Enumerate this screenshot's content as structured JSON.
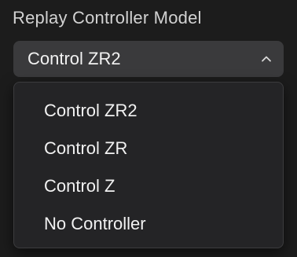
{
  "field": {
    "label": "Replay Controller Model"
  },
  "select": {
    "value": "Control ZR2",
    "chevron_icon": "chevron-up-icon"
  },
  "menu": {
    "items": [
      {
        "label": "Control ZR2"
      },
      {
        "label": "Control ZR"
      },
      {
        "label": "Control Z"
      },
      {
        "label": "No Controller"
      }
    ]
  },
  "colors": {
    "background": "#1c1c1c",
    "select_bg": "#3a3a3c",
    "menu_bg": "#242426",
    "text": "#f2f2f2",
    "label_text": "#d2d2d2"
  }
}
